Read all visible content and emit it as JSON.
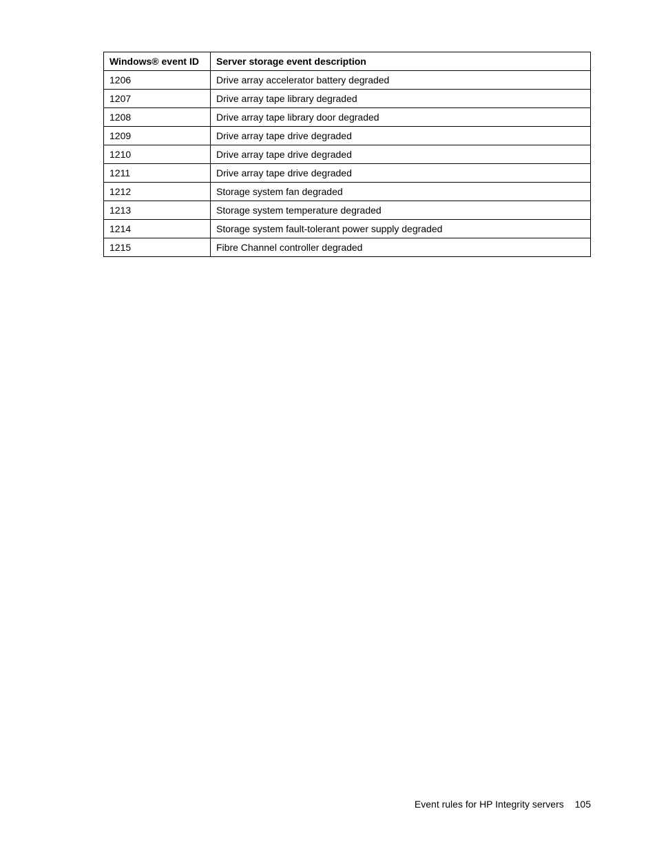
{
  "table": {
    "headers": {
      "event_id": "Windows® event ID",
      "description": "Server storage event description"
    },
    "rows": [
      {
        "event_id": "1206",
        "description": "Drive array accelerator battery degraded"
      },
      {
        "event_id": "1207",
        "description": "Drive array tape library degraded"
      },
      {
        "event_id": "1208",
        "description": "Drive array tape library door degraded"
      },
      {
        "event_id": "1209",
        "description": "Drive array tape drive degraded"
      },
      {
        "event_id": "1210",
        "description": "Drive array tape drive degraded"
      },
      {
        "event_id": "1211",
        "description": "Drive array tape drive degraded"
      },
      {
        "event_id": "1212",
        "description": "Storage system fan degraded"
      },
      {
        "event_id": "1213",
        "description": "Storage system temperature degraded"
      },
      {
        "event_id": "1214",
        "description": "Storage system fault-tolerant power supply degraded"
      },
      {
        "event_id": "1215",
        "description": "Fibre Channel controller degraded"
      }
    ]
  },
  "footer": {
    "text": "Event rules for HP Integrity servers",
    "page_number": "105"
  }
}
